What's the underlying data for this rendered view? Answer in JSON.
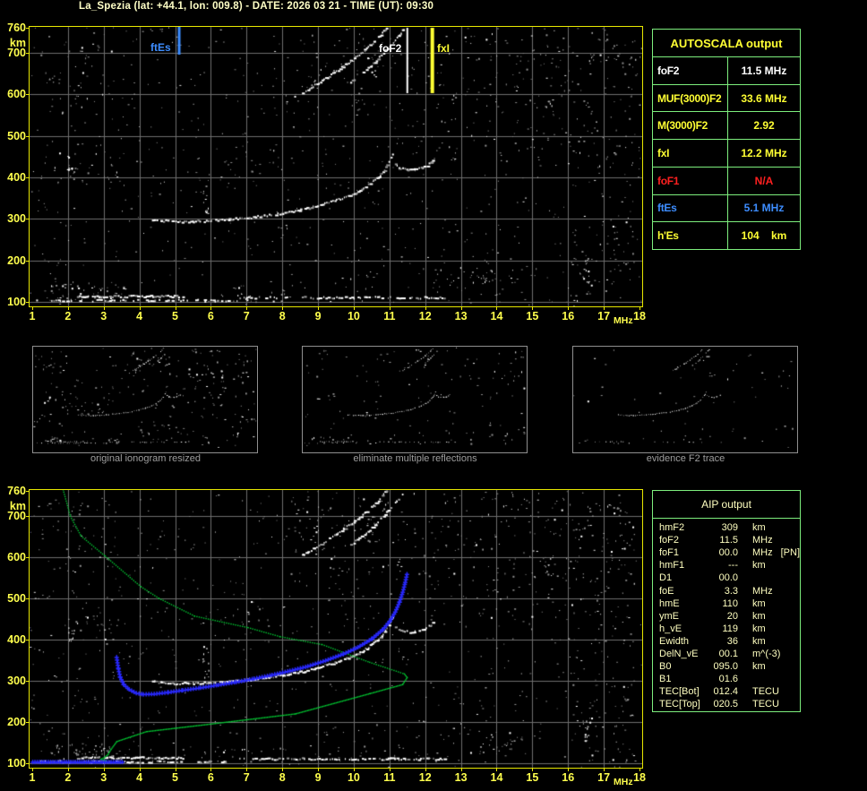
{
  "title": "La_Spezia (lat: +44.1, lon: 009.8) - DATE: 2026 03 21 - TIME (UT): 09:30",
  "colors": {
    "background": "#000000",
    "plot_border_yellow": "#e8e800",
    "axis_label_yellow": "#ffff4d",
    "grid_gray": "#6e6e6e",
    "table_border_green": "#7dee7d",
    "title_cream": "#ffffc6",
    "marker_blue": "#3d8dff",
    "marker_white": "#ffffff",
    "marker_yellow": "#ffff33",
    "red": "#ff2020",
    "aip_text": "#ffffc0",
    "profile_green": "#00cc33",
    "trace_blue": "#2929ff",
    "caption_gray": "#9e9e9e"
  },
  "main_plot": {
    "x_ticks": [
      "1",
      "2",
      "3",
      "4",
      "5",
      "6",
      "7",
      "8",
      "9",
      "10",
      "11",
      "12",
      "13",
      "14",
      "15",
      "16",
      "17",
      "18"
    ],
    "x_unit": "MHz",
    "y_ticks": [
      "760",
      "700",
      "600",
      "500",
      "400",
      "300",
      "200",
      "100"
    ],
    "y_tick_values": [
      760,
      700,
      600,
      500,
      400,
      300,
      200,
      100
    ],
    "y_unit": "km",
    "x_range": [
      1,
      18
    ],
    "y_range": [
      100,
      760
    ],
    "markers": {
      "ftEs": {
        "label": "ftEs",
        "freq_mhz": 5.1,
        "color": "#3d8dff"
      },
      "foF2": {
        "label": "foF2",
        "freq_mhz": 11.5,
        "color": "#ffffff"
      },
      "fxI": {
        "label": "fxI",
        "freq_mhz": 12.2,
        "color": "#ffff33"
      }
    }
  },
  "autoscala_table": {
    "title": "AUTOSCALA output",
    "rows": [
      {
        "param": "foF2",
        "value": "11.5 MHz",
        "color": "#ffffff"
      },
      {
        "param": "MUF(3000)F2",
        "value": "33.6 MHz",
        "color": "#ffff33"
      },
      {
        "param": "M(3000)F2",
        "value": "2.92",
        "color": "#ffff33"
      },
      {
        "param": "fxI",
        "value": "12.2 MHz",
        "color": "#ffff33"
      },
      {
        "param": "foF1",
        "value": "N/A",
        "color": "#ff2020"
      },
      {
        "param": "ftEs",
        "value": "5.1 MHz",
        "color": "#3d8dff"
      },
      {
        "param": "h'Es",
        "value": "104    km",
        "color": "#ffff33"
      }
    ]
  },
  "thumbnails": [
    {
      "caption": "original ionogram resized"
    },
    {
      "caption": "eliminate multiple reflections"
    },
    {
      "caption": "evidence F2 trace"
    }
  ],
  "aip_table": {
    "title": "AIP output",
    "rows": [
      {
        "param": "hmF2",
        "value": "309",
        "unit": "km",
        "extra": ""
      },
      {
        "param": "foF2",
        "value": "11.5",
        "unit": "MHz",
        "extra": ""
      },
      {
        "param": "foF1",
        "value": "00.0",
        "unit": "MHz",
        "extra": "[PN]"
      },
      {
        "param": "hmF1",
        "value": "---",
        "unit": "km",
        "extra": ""
      },
      {
        "param": "D1",
        "value": "00.0",
        "unit": "",
        "extra": ""
      },
      {
        "param": "foE",
        "value": "3.3",
        "unit": "MHz",
        "extra": ""
      },
      {
        "param": "hmE",
        "value": "110",
        "unit": "km",
        "extra": ""
      },
      {
        "param": "ymE",
        "value": "20",
        "unit": "km",
        "extra": ""
      },
      {
        "param": "h_vE",
        "value": "119",
        "unit": "km",
        "extra": ""
      },
      {
        "param": "Ewidth",
        "value": "36",
        "unit": "km",
        "extra": ""
      },
      {
        "param": "DelN_vE",
        "value": "00.1",
        "unit": "m^(-3)",
        "extra": ""
      },
      {
        "param": "B0",
        "value": "095.0",
        "unit": "km",
        "extra": ""
      },
      {
        "param": "B1",
        "value": "01.6",
        "unit": "",
        "extra": ""
      },
      {
        "param": "TEC[Bot]",
        "value": "012.4",
        "unit": "TECU",
        "extra": ""
      },
      {
        "param": "TEC[Top]",
        "value": "020.5",
        "unit": "TECU",
        "extra": ""
      }
    ]
  },
  "chart_data": [
    {
      "type": "scatter",
      "title": "main ionogram (virtual height vs frequency)",
      "xlabel": "MHz",
      "ylabel": "km",
      "xlim": [
        1,
        18
      ],
      "ylim": [
        100,
        760
      ],
      "grid": true,
      "markers": {
        "ftEs_MHz": 5.1,
        "foF2_MHz": 11.5,
        "fxI_MHz": 12.2
      },
      "series": [
        {
          "name": "F2 ordinary trace",
          "color": "#ffffff",
          "points": [
            [
              4.35,
              300
            ],
            [
              4.6,
              297
            ],
            [
              5.0,
              295
            ],
            [
              5.5,
              295
            ],
            [
              6.0,
              297
            ],
            [
              6.5,
              300
            ],
            [
              7.0,
              304
            ],
            [
              7.5,
              309
            ],
            [
              8.0,
              315
            ],
            [
              8.5,
              323
            ],
            [
              9.0,
              333
            ],
            [
              9.5,
              346
            ],
            [
              10.0,
              363
            ],
            [
              10.35,
              380
            ],
            [
              10.65,
              400
            ],
            [
              10.85,
              420
            ],
            [
              11.0,
              442
            ],
            [
              11.08,
              458
            ]
          ]
        },
        {
          "name": "F2 extraordinary trace",
          "color": "#ffffff",
          "points": [
            [
              11.15,
              432
            ],
            [
              11.3,
              424
            ],
            [
              11.5,
              420
            ],
            [
              11.7,
              420
            ],
            [
              11.9,
              424
            ],
            [
              12.05,
              430
            ],
            [
              12.15,
              437
            ],
            [
              12.22,
              443
            ]
          ]
        },
        {
          "name": "second hop trace O",
          "color": "#ffffff",
          "points": [
            [
              8.55,
              605
            ],
            [
              8.8,
              618
            ],
            [
              9.1,
              634
            ],
            [
              9.4,
              651
            ],
            [
              9.7,
              669
            ],
            [
              10.0,
              688
            ],
            [
              10.3,
              708
            ],
            [
              10.55,
              727
            ],
            [
              10.75,
              745
            ],
            [
              10.9,
              762
            ]
          ]
        },
        {
          "name": "second hop trace X",
          "color": "#c8c8c8",
          "points": [
            [
              9.9,
              630
            ],
            [
              10.15,
              648
            ],
            [
              10.45,
              668
            ],
            [
              10.7,
              690
            ],
            [
              10.95,
              714
            ],
            [
              11.2,
              738
            ],
            [
              11.4,
              760
            ]
          ]
        },
        {
          "name": "Es layer echo",
          "color": "#ffffff",
          "points": [
            [
              2.25,
              115
            ],
            [
              5.2,
              115
            ]
          ]
        },
        {
          "name": "Es layer echo extension",
          "color": "#ffffff",
          "points": [
            [
              6.8,
              112
            ],
            [
              12.6,
              112
            ]
          ]
        },
        {
          "name": "E region scatter",
          "color": "#aaaaaa",
          "points": [
            [
              1.05,
              105
            ],
            [
              6.5,
              105
            ]
          ]
        }
      ]
    },
    {
      "type": "scatter",
      "title": "AIP inversion plot (profile + restored trace over ionogram)",
      "xlabel": "MHz",
      "ylabel": "km",
      "xlim": [
        1,
        18
      ],
      "ylim": [
        100,
        760
      ],
      "grid": true,
      "series": [
        {
          "name": "electron density profile",
          "color": "#00cc33",
          "points": [
            [
              1.85,
              764
            ],
            [
              2.05,
              700
            ],
            [
              2.35,
              652
            ],
            [
              3.03,
              603
            ],
            [
              4.03,
              529
            ],
            [
              4.53,
              501
            ],
            [
              5.53,
              458
            ],
            [
              7.03,
              430
            ],
            [
              7.93,
              408
            ],
            [
              9.1,
              389
            ],
            [
              10.43,
              346
            ],
            [
              11.4,
              318
            ],
            [
              11.48,
              309
            ],
            [
              11.35,
              292
            ],
            [
              10.43,
              270
            ],
            [
              8.35,
              221
            ],
            [
              5.85,
              195
            ],
            [
              4.18,
              178
            ],
            [
              3.35,
              154
            ],
            [
              3.18,
              134
            ],
            [
              3.1,
              122
            ],
            [
              3.0,
              115
            ],
            [
              2.9,
              111
            ],
            [
              3.03,
              108
            ],
            [
              3.1,
              104
            ]
          ]
        },
        {
          "name": "restored F trace",
          "color": "#2929ff",
          "points": [
            [
              3.35,
              358
            ],
            [
              3.4,
              330
            ],
            [
              3.45,
              310
            ],
            [
              3.55,
              292
            ],
            [
              3.7,
              280
            ],
            [
              3.9,
              271
            ],
            [
              4.1,
              268
            ],
            [
              4.4,
              269
            ],
            [
              4.8,
              273
            ],
            [
              5.2,
              278
            ],
            [
              5.7,
              284
            ],
            [
              6.2,
              291
            ],
            [
              6.7,
              298
            ],
            [
              7.2,
              306
            ],
            [
              7.7,
              315
            ],
            [
              8.2,
              325
            ],
            [
              8.7,
              336
            ],
            [
              9.2,
              350
            ],
            [
              9.7,
              366
            ],
            [
              10.1,
              382
            ],
            [
              10.5,
              403
            ],
            [
              10.8,
              425
            ],
            [
              11.0,
              446
            ],
            [
              11.15,
              468
            ],
            [
              11.27,
              492
            ],
            [
              11.36,
              516
            ],
            [
              11.43,
              540
            ],
            [
              11.48,
              560
            ]
          ]
        },
        {
          "name": "restored Es line",
          "color": "#2929ff",
          "points": [
            [
              1.0,
              104
            ],
            [
              3.55,
              104
            ]
          ]
        }
      ]
    }
  ]
}
